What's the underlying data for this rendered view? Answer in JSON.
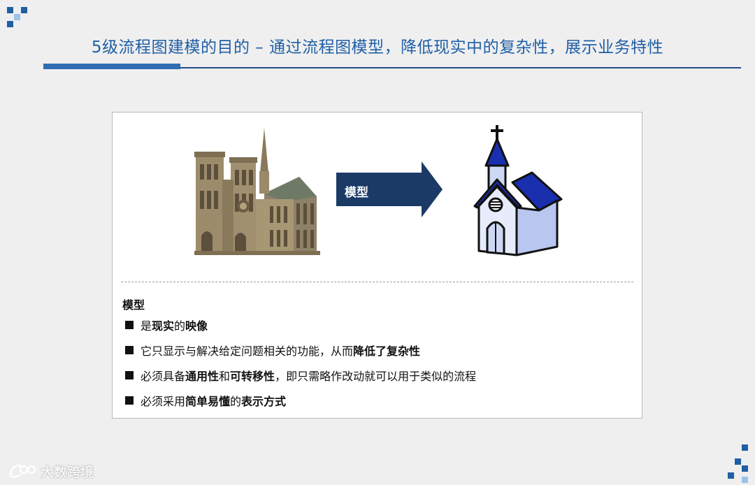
{
  "header": {
    "title": "5级流程图建模的目的 – 通过流程图模型，降低现实中的复杂性，展示业务特性"
  },
  "diagram": {
    "arrow_label": "模型",
    "colors": {
      "arrow": "#1b3a66",
      "church_roof": "#1a2fae",
      "church_wall": "#cdd8f5"
    }
  },
  "model_section": {
    "heading": "模型",
    "bullets": [
      {
        "parts": [
          {
            "text": "是"
          },
          {
            "text": "现实",
            "bold": true
          },
          {
            "text": "的"
          },
          {
            "text": "映像",
            "bold": true
          }
        ]
      },
      {
        "parts": [
          {
            "text": "它只显示与解决给定问题相关的功能，从而"
          },
          {
            "text": "降低了复杂性",
            "bold": true
          }
        ]
      },
      {
        "parts": [
          {
            "text": "必须具备"
          },
          {
            "text": "通用性",
            "bold": true
          },
          {
            "text": "和"
          },
          {
            "text": "可转移性",
            "bold": true
          },
          {
            "text": "，即只需略作改动就可以用于类似的流程"
          }
        ]
      },
      {
        "parts": [
          {
            "text": "必须采用"
          },
          {
            "text": "简单易懂",
            "bold": true
          },
          {
            "text": "的"
          },
          {
            "text": "表示方式",
            "bold": true
          }
        ]
      }
    ]
  },
  "watermark": {
    "text": "大数跨境",
    "icon": "bubble-logo-icon"
  }
}
